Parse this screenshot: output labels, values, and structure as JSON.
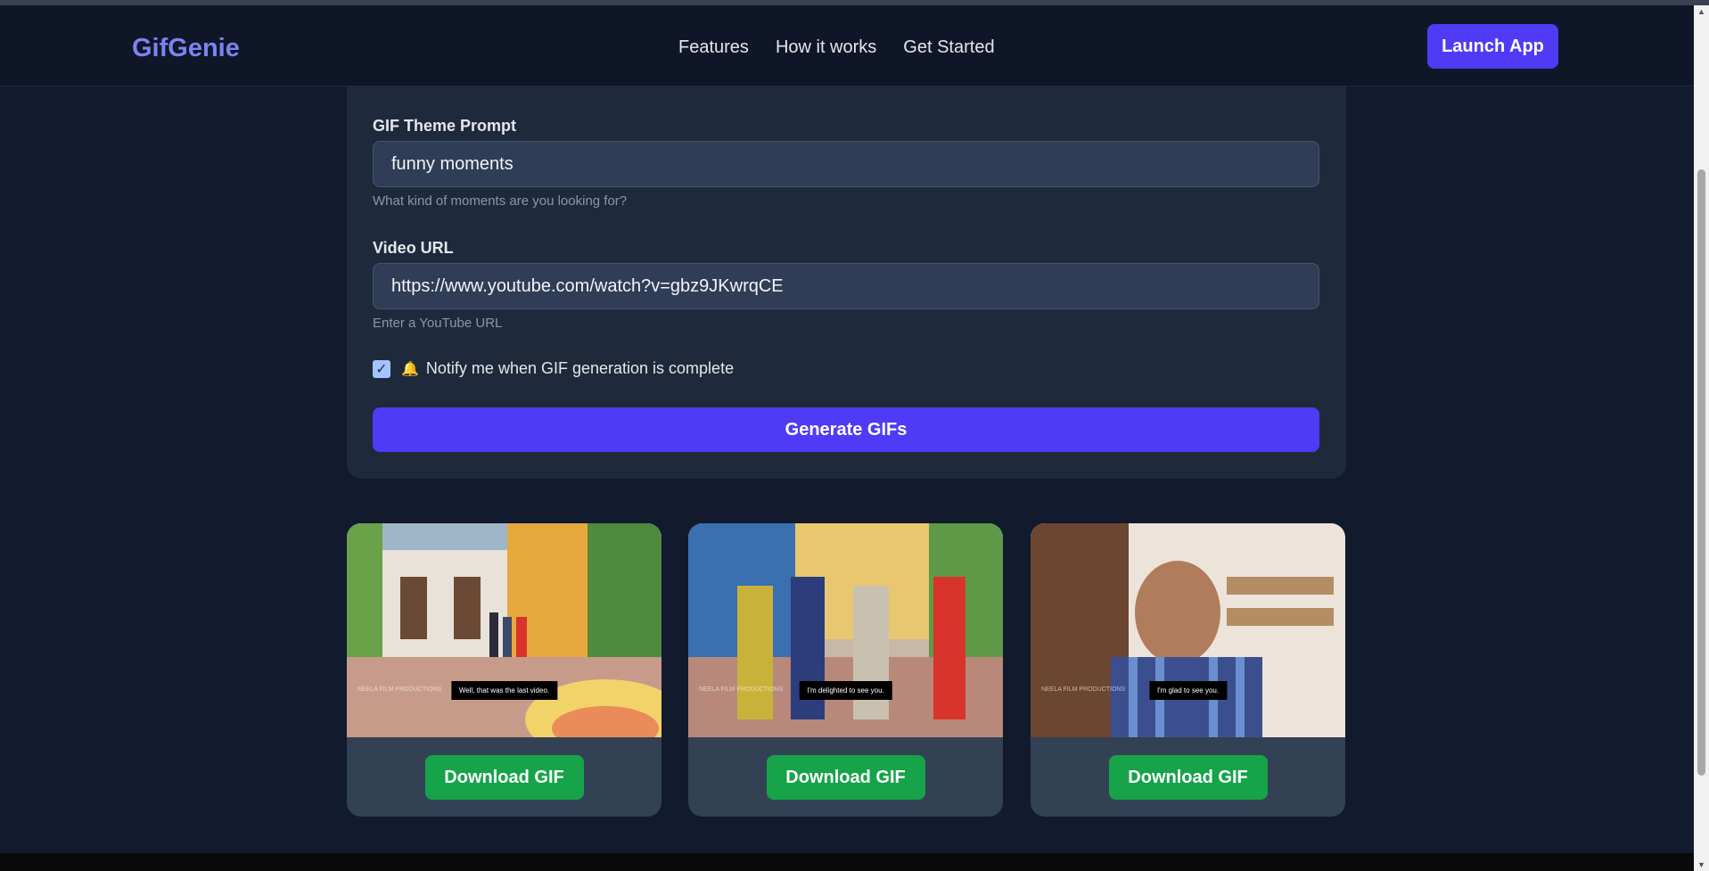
{
  "nav": {
    "brand": "GifGenie",
    "links": [
      "Features",
      "How it works",
      "Get Started"
    ],
    "launch_label": "Launch App"
  },
  "form": {
    "theme_label": "GIF Theme Prompt",
    "theme_value": "funny moments",
    "theme_hint": "What kind of moments are you looking for?",
    "url_label": "Video URL",
    "url_value": "https://www.youtube.com/watch?v=gbz9JKwrqCE",
    "url_hint": "Enter a YouTube URL",
    "notify_checked": true,
    "notify_icon": "bell-icon",
    "notify_label": "Notify me when GIF generation is complete",
    "generate_label": "Generate GIFs"
  },
  "gifs": [
    {
      "caption": "Well, that was the last video.",
      "watermark": "NEELA FILM PRODUCTIONS",
      "download_label": "Download GIF"
    },
    {
      "caption": "I'm delighted to see you.",
      "watermark": "NEELA FILM PRODUCTIONS",
      "download_label": "Download GIF"
    },
    {
      "caption": "I'm glad to see you.",
      "watermark": "NEELA FILM PRODUCTIONS",
      "download_label": "Download GIF"
    }
  ],
  "colors": {
    "background": "#121a2d",
    "accent": "#4f3bf5",
    "brand": "#7c83f0",
    "success": "#16a34a",
    "card": "#1e293b"
  }
}
